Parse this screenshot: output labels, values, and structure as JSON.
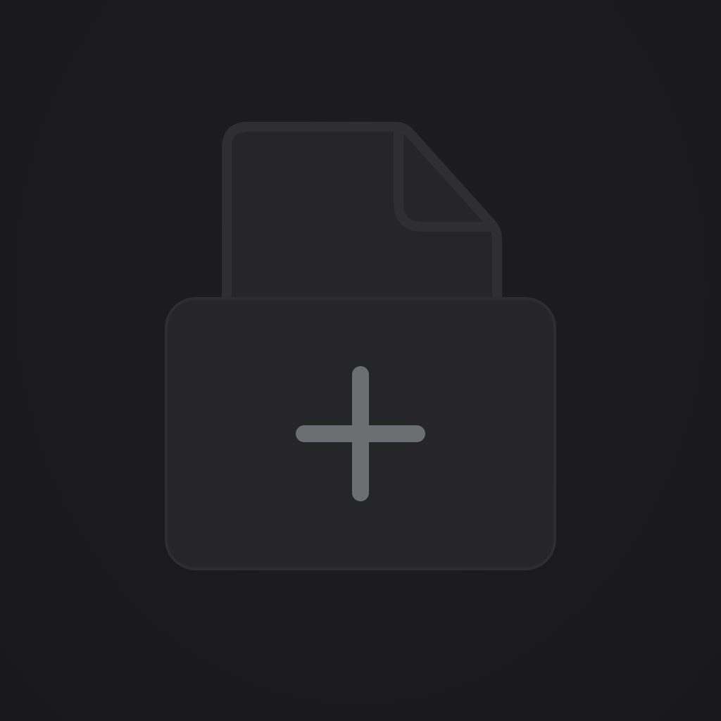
{
  "icon": {
    "name": "new-document-tray-icon",
    "document_name": "document-icon",
    "tray_name": "tray-icon",
    "plus_name": "plus-icon"
  },
  "colors": {
    "background": "#1b1b1d",
    "document_fill": "#262628",
    "document_stroke": "#2f2f31",
    "tray_fill": "#262628",
    "tray_stroke": "#2e2e30",
    "plus": "#6c6e71"
  }
}
